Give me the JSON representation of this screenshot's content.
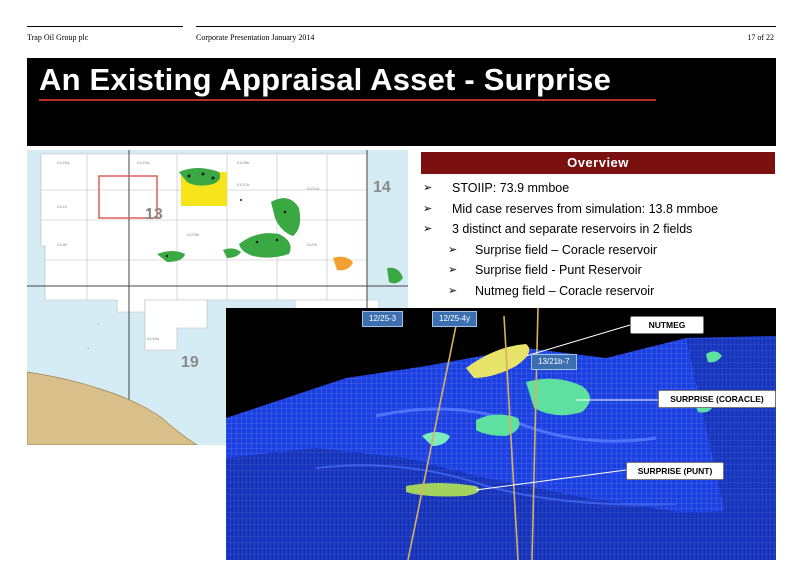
{
  "header": {
    "company": "Trap Oil Group plc",
    "presentation": "Corporate Presentation January 2014",
    "page": "17 of 22"
  },
  "title": "An Existing Appraisal Asset - Surprise",
  "overview": {
    "heading": "Overview",
    "bullets": [
      {
        "level": 1,
        "text": "STOIIP: 73.9 mmboe"
      },
      {
        "level": 1,
        "text": "Mid case reserves from simulation: 13.8 mmboe"
      },
      {
        "level": 1,
        "text": "3 distinct and separate reservoirs in 2 fields"
      },
      {
        "level": 2,
        "text": "Surprise field – Coracle reservoir"
      },
      {
        "level": 2,
        "text": "Surprise field -  Punt Reservoir"
      },
      {
        "level": 2,
        "text": "Nutmeg field – Coracle reservoir"
      }
    ]
  },
  "map": {
    "blocks": [
      "14",
      "13",
      "19"
    ],
    "colors": {
      "sea": "#d6ecf5",
      "licence": "#ffffff",
      "land": "#d9c08a",
      "field": "#3aa843",
      "highlight": "#f5e51a",
      "outline": "#d9534f"
    }
  },
  "model": {
    "wells": [
      "12/25-3",
      "12/25-4y",
      "13/21b-7"
    ],
    "labels": [
      "NUTMEG",
      "SURPRISE (CORACLE)",
      "SURPRISE (PUNT)"
    ],
    "colors": {
      "grid": "#1a3fd6",
      "reservoir": "#5ee0a0",
      "well": "#d8b060"
    }
  }
}
